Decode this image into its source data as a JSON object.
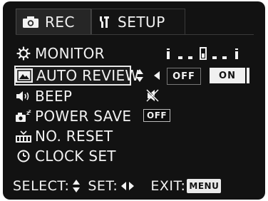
{
  "tabs": [
    {
      "label": "REC",
      "icon": "camera-icon",
      "active": false
    },
    {
      "label": "SETUP",
      "icon": "setup-wrench-icon",
      "active": true
    }
  ],
  "menu": {
    "items": [
      {
        "label": "MONITOR",
        "icon": "gear-icon"
      },
      {
        "label": "AUTO REVIEW",
        "icon": "review-icon",
        "selected": true
      },
      {
        "label": "BEEP",
        "icon": "speaker-icon",
        "value": "mute"
      },
      {
        "label": "POWER SAVE",
        "icon": "power-save-icon",
        "value": "OFF"
      },
      {
        "label": "NO. RESET",
        "icon": "number-reset-icon"
      },
      {
        "label": "CLOCK SET",
        "icon": "clock-icon"
      }
    ]
  },
  "auto_review": {
    "options": [
      "OFF",
      "ON"
    ],
    "selected": "ON"
  },
  "monitor_level": 3,
  "footer": {
    "select_label": "SELECT:",
    "set_label": "SET:",
    "exit_label": "EXIT:",
    "menu_button": "MENU"
  },
  "colors": {
    "background": "#121212",
    "foreground": "#f2f2f2",
    "highlight": "#f0f0f0"
  }
}
